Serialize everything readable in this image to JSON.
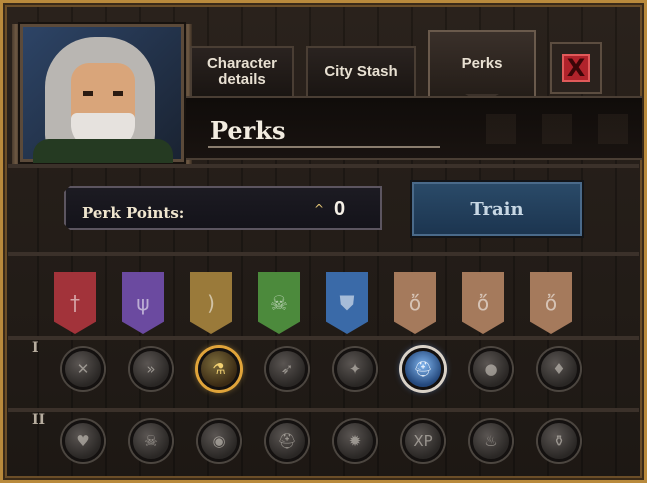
{
  "tabs": [
    {
      "label": "Character details"
    },
    {
      "label": "City Stash"
    },
    {
      "label": "Perks"
    }
  ],
  "title": "Perks",
  "perk_points": {
    "label": "Perk Points:",
    "chevron": "^",
    "value": "0"
  },
  "train_label": "Train",
  "close_glyph": "X",
  "colors": {
    "frame_gold": "#b98a3c",
    "banner_red": "#a2333a",
    "banner_purple": "#6b4aa0",
    "banner_gold": "#9a7a3a",
    "banner_green": "#4c8a3c",
    "banner_blue": "#3a6aa8",
    "banner_tan": "#a57a5c"
  },
  "banners": [
    {
      "icon": "sword-icon",
      "glyph": "†",
      "color": "#a2333a"
    },
    {
      "icon": "staff-icon",
      "glyph": "ψ",
      "color": "#6b4aa0"
    },
    {
      "icon": "bow-icon",
      "glyph": ")",
      "color": "#9a7a3a"
    },
    {
      "icon": "skull-flask-icon",
      "glyph": "☠",
      "color": "#4c8a3c"
    },
    {
      "icon": "shield-icon",
      "glyph": "⛊",
      "color": "#3a6aa8"
    },
    {
      "icon": "sack-icon",
      "glyph": "ὄ",
      "color": "#a57a5c"
    },
    {
      "icon": "sack-icon",
      "glyph": "ὄ",
      "color": "#a57a5c"
    },
    {
      "icon": "sack-icon",
      "glyph": "ὄ",
      "color": "#a57a5c"
    }
  ],
  "rows": [
    {
      "label": "I",
      "perks": [
        {
          "icon": "crossed-blades-icon",
          "glyph": "✕",
          "state": "normal"
        },
        {
          "icon": "swift-strike-icon",
          "glyph": "»",
          "state": "normal"
        },
        {
          "icon": "colored-flasks-icon",
          "glyph": "⚗",
          "state": "gold"
        },
        {
          "icon": "dash-attack-icon",
          "glyph": "➶",
          "state": "normal"
        },
        {
          "icon": "stars-icon",
          "glyph": "✦",
          "state": "normal"
        },
        {
          "icon": "helmet-icon",
          "glyph": "⛑",
          "state": "blue"
        },
        {
          "icon": "orb-icon",
          "glyph": "●",
          "state": "normal"
        },
        {
          "icon": "pouch-icon",
          "glyph": "♦",
          "state": "normal"
        }
      ]
    },
    {
      "label": "II",
      "perks": [
        {
          "icon": "heart-sword-icon",
          "glyph": "♥",
          "state": "normal"
        },
        {
          "icon": "skull-icon",
          "glyph": "☠",
          "state": "normal"
        },
        {
          "icon": "skull-eye-icon",
          "glyph": "◉",
          "state": "normal"
        },
        {
          "icon": "helmet-icon",
          "glyph": "⛑",
          "state": "normal"
        },
        {
          "icon": "flame-icon",
          "glyph": "✹",
          "state": "normal"
        },
        {
          "icon": "xp-icon",
          "glyph": "XP",
          "state": "normal"
        },
        {
          "icon": "potion-icon",
          "glyph": "♨",
          "state": "normal"
        },
        {
          "icon": "potions-icon",
          "glyph": "⚱",
          "state": "normal"
        }
      ]
    }
  ]
}
